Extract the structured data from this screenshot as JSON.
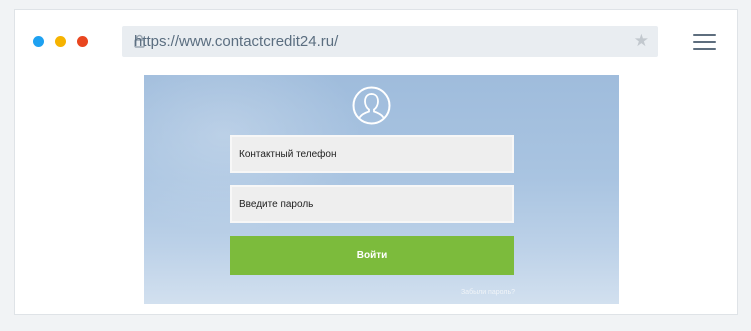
{
  "browser": {
    "url": "https://www.contactcredit24.ru/",
    "icons": [
      "lock-icon",
      "star-icon",
      "menu-icon"
    ],
    "window_dots": [
      "#1ea1f1",
      "#f6b300",
      "#e9461f"
    ]
  },
  "login": {
    "phone_placeholder": "Контактный телефон",
    "password_placeholder": "Введите пароль",
    "submit_label": "Войти",
    "forgot_link": "Забыли пароль?",
    "accent_color": "#7cbb3c"
  }
}
